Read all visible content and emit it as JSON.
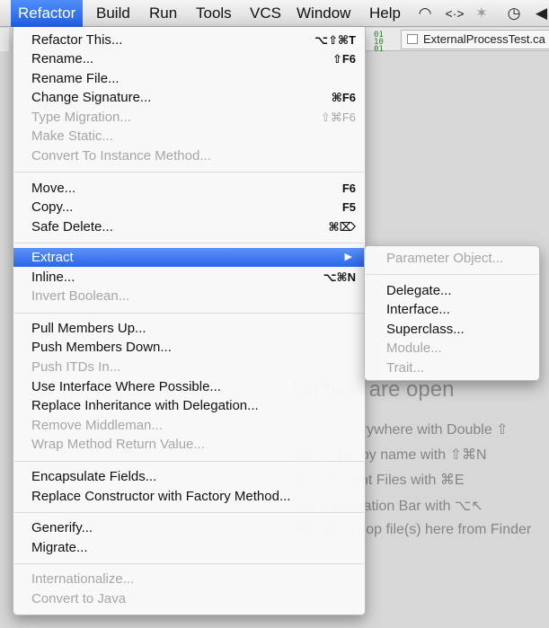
{
  "menubar": {
    "items": [
      "Refactor",
      "Build",
      "Run",
      "Tools",
      "VCS",
      "Window",
      "Help"
    ],
    "active": "Refactor",
    "status_icons": [
      "wifi-icon",
      "code-arrows-icon",
      "bluetooth-icon",
      "time-machine-icon",
      "volume-icon"
    ],
    "status_glyphs": {
      "wifi": "◠",
      "code_arrows": "<·>",
      "bluetooth": "✶",
      "time_machine": "◷",
      "volume": "◀"
    }
  },
  "editor": {
    "tab_label": "ExternalProcessTest.ca",
    "tab_icon_text": "01\n10\n01",
    "empty_title": "No files are open",
    "hints": [
      "• Search Everywhere with Double ⇧",
      "• Open a file by name with ⇧⌘N",
      "• Open Recent Files with ⌘E",
      "• Open Navigation Bar with ⌥↖",
      "• Drag and Drop file(s) here from Finder"
    ]
  },
  "menu": {
    "groups": [
      [
        {
          "label": "Refactor This...",
          "shortcut": "⌥⇧⌘T",
          "enabled": true
        },
        {
          "label": "Rename...",
          "shortcut": "⇧F6",
          "enabled": true
        },
        {
          "label": "Rename File...",
          "shortcut": "",
          "enabled": true
        },
        {
          "label": "Change Signature...",
          "shortcut": "⌘F6",
          "enabled": true
        },
        {
          "label": "Type Migration...",
          "shortcut": "⇧⌘F6",
          "enabled": false
        },
        {
          "label": "Make Static...",
          "shortcut": "",
          "enabled": false
        },
        {
          "label": "Convert To Instance Method...",
          "shortcut": "",
          "enabled": false
        }
      ],
      [
        {
          "label": "Move...",
          "shortcut": "F6",
          "enabled": true
        },
        {
          "label": "Copy...",
          "shortcut": "F5",
          "enabled": true
        },
        {
          "label": "Safe Delete...",
          "shortcut": "⌘⌦",
          "enabled": true
        }
      ],
      [
        {
          "label": "Extract",
          "shortcut": "▶",
          "enabled": true,
          "highlighted": true,
          "submenu": true
        },
        {
          "label": "Inline...",
          "shortcut": "⌥⌘N",
          "enabled": true
        },
        {
          "label": "Invert Boolean...",
          "shortcut": "",
          "enabled": false
        }
      ],
      [
        {
          "label": "Pull Members Up...",
          "shortcut": "",
          "enabled": true
        },
        {
          "label": "Push Members Down...",
          "shortcut": "",
          "enabled": true
        },
        {
          "label": "Push ITDs In...",
          "shortcut": "",
          "enabled": false
        },
        {
          "label": "Use Interface Where Possible...",
          "shortcut": "",
          "enabled": true
        },
        {
          "label": "Replace Inheritance with Delegation...",
          "shortcut": "",
          "enabled": true
        },
        {
          "label": "Remove Middleman...",
          "shortcut": "",
          "enabled": false
        },
        {
          "label": "Wrap Method Return Value...",
          "shortcut": "",
          "enabled": false
        }
      ],
      [
        {
          "label": "Encapsulate Fields...",
          "shortcut": "",
          "enabled": true
        },
        {
          "label": "Replace Constructor with Factory Method...",
          "shortcut": "",
          "enabled": true
        }
      ],
      [
        {
          "label": "Generify...",
          "shortcut": "",
          "enabled": true
        },
        {
          "label": "Migrate...",
          "shortcut": "",
          "enabled": true
        }
      ],
      [
        {
          "label": "Internationalize...",
          "shortcut": "",
          "enabled": false
        },
        {
          "label": "Convert to Java",
          "shortcut": "",
          "enabled": false
        }
      ]
    ]
  },
  "submenu": {
    "groups": [
      [
        {
          "label": "Parameter Object...",
          "enabled": false
        }
      ],
      [
        {
          "label": "Delegate...",
          "enabled": true
        },
        {
          "label": "Interface...",
          "enabled": true
        },
        {
          "label": "Superclass...",
          "enabled": true
        },
        {
          "label": "Module...",
          "enabled": false
        },
        {
          "label": "Trait...",
          "enabled": false
        }
      ]
    ]
  }
}
